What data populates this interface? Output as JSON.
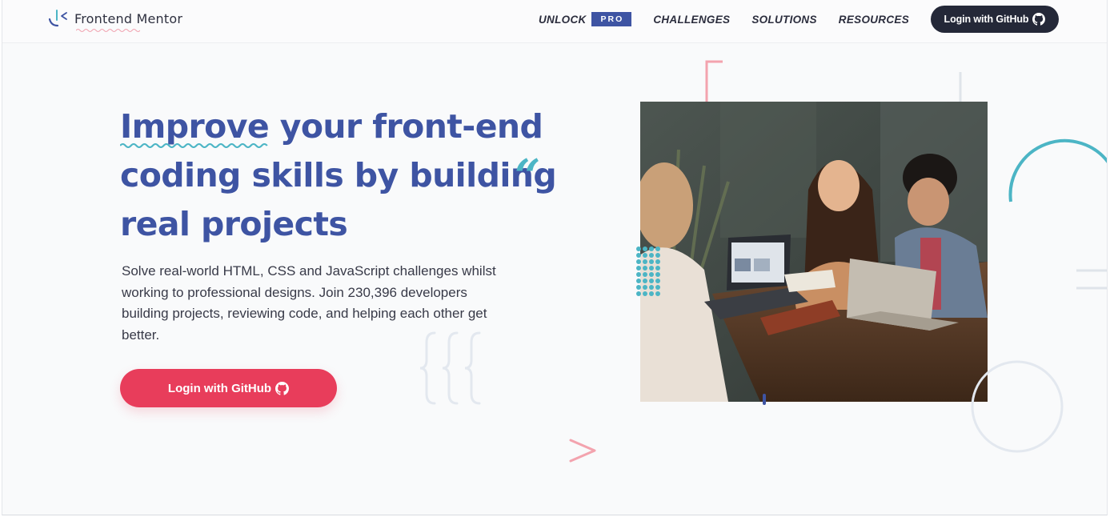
{
  "header": {
    "logo_text": "Frontend Mentor",
    "nav": {
      "unlock_label": "UNLOCK",
      "pro_badge": "PRO",
      "challenges_label": "CHALLENGES",
      "solutions_label": "SOLUTIONS",
      "resources_label": "RESOURCES",
      "login_label": "Login with GitHub"
    }
  },
  "hero": {
    "title_highlight": "Improve",
    "title_rest_line1": " your front-end",
    "title_line2": "coding skills by building",
    "title_line3": "real projects",
    "description": "Solve real-world HTML, CSS and JavaScript challenges whilst working to professional designs. Join 230,396 developers building projects, reviewing code, and helping each other get better.",
    "cta_label": "Login with GitHub"
  },
  "icons": {
    "github": "github-icon",
    "logo": "frontend-mentor-logo-icon"
  },
  "colors": {
    "primary_blue": "#3e54a3",
    "accent_red": "#e83d5b",
    "accent_teal": "#4cb5c5",
    "dark": "#242838"
  }
}
